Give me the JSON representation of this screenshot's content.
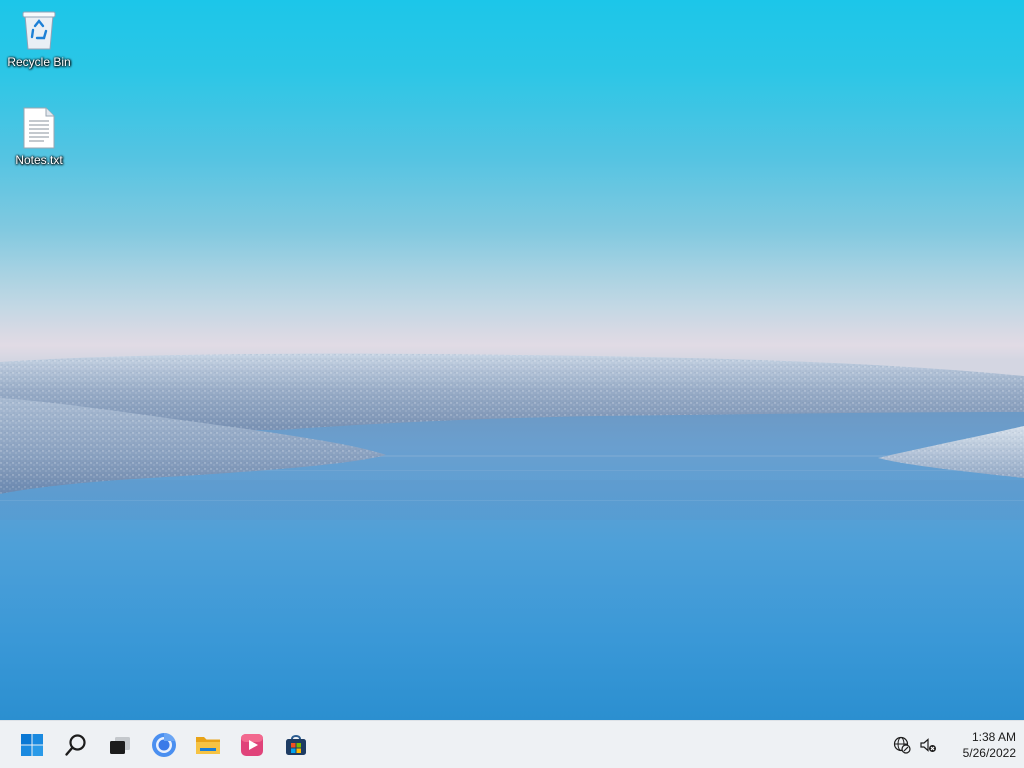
{
  "desktop": {
    "icons": [
      {
        "label": "Recycle Bin",
        "icon": "recycle-bin-icon"
      },
      {
        "label": "Notes.txt",
        "icon": "text-file-icon"
      }
    ]
  },
  "taskbar": {
    "pinned": [
      {
        "name": "Start",
        "icon": "windows-start-icon"
      },
      {
        "name": "Search",
        "icon": "search-icon"
      },
      {
        "name": "Task View",
        "icon": "task-view-icon"
      },
      {
        "name": "Google Chrome",
        "icon": "chrome-icon"
      },
      {
        "name": "File Explorer",
        "icon": "folder-icon"
      },
      {
        "name": "Clipchamp",
        "icon": "clipchamp-icon"
      },
      {
        "name": "Microsoft Store",
        "icon": "store-icon"
      }
    ],
    "tray": {
      "network_icon": "network-globe-icon",
      "volume_icon": "volume-muted-icon"
    },
    "clock": {
      "time": "1:38 AM",
      "date": "5/26/2022"
    }
  },
  "colors": {
    "sky_top": "#1cc6e9",
    "horizon": "#e1dbe5",
    "water": "#2b8fd0",
    "taskbar": "#eef1f4",
    "start_blue": "#0a78d4"
  }
}
